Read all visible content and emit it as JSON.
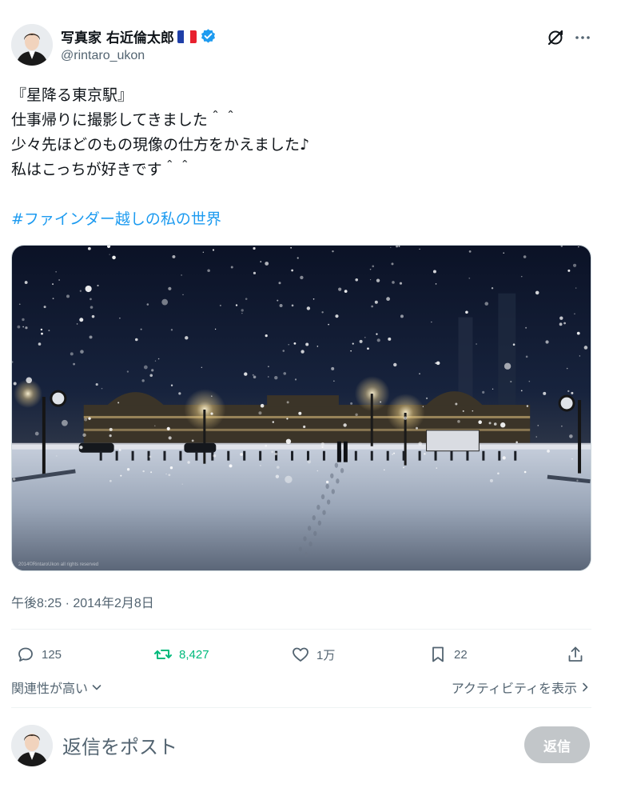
{
  "author": {
    "name": "写真家 右近倫太郎",
    "flag_icon": "france-flag-icon",
    "verified_icon": "verified-badge-icon",
    "handle": "@rintaro_ukon"
  },
  "top_actions": {
    "grok_icon": "grok-icon",
    "more_icon": "more-icon"
  },
  "post": {
    "lines": [
      "『星降る東京駅』",
      "仕事帰りに撮影してきました＾＾",
      "少々先ほどのもの現像の仕方をかえました♪",
      "私はこっちが好きです＾＾"
    ],
    "hashtag": "#ファインダー越しの私の世界",
    "image_watermark": "2014©RintaroUkon all rights reserved",
    "timestamp": "午後8:25 · 2014年2月8日"
  },
  "actions": {
    "reply_count": "125",
    "retweet_count": "8,427",
    "like_count": "1万",
    "bookmark_count": "22"
  },
  "sort": {
    "relevance_label": "関連性が高い",
    "activity_label": "アクティビティを表示"
  },
  "reply_box": {
    "placeholder": "返信をポスト",
    "button_label": "返信"
  },
  "colors": {
    "accent": "#1d9bf0",
    "retweet": "#00ba7c",
    "muted": "#536471",
    "reply_button_disabled": "#c2c6c9"
  }
}
